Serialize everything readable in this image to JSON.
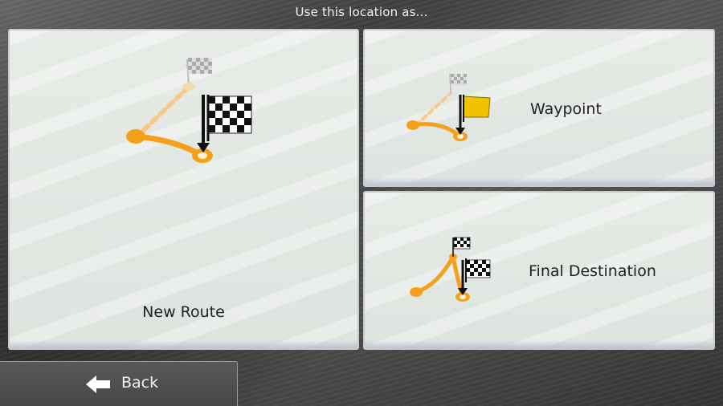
{
  "dialog": {
    "title": "Use this location as..."
  },
  "options": [
    {
      "label": "New Route",
      "icon": "new-route-icon"
    },
    {
      "label": "Waypoint",
      "icon": "waypoint-icon"
    },
    {
      "label": "Final Destination",
      "icon": "final-destination-icon"
    }
  ],
  "footer": {
    "back_label": "Back",
    "back_icon": "arrow-left-icon"
  },
  "colors": {
    "route_orange": "#f5a01a",
    "waypoint_flag": "#f2c200",
    "tile_bg": "#e3e8e4",
    "background": "#4a4a4a"
  }
}
